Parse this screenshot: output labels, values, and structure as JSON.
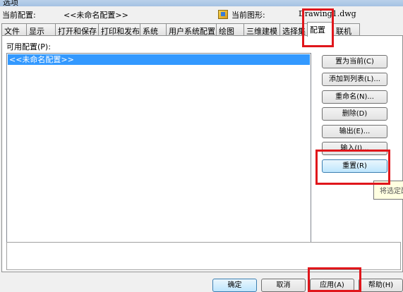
{
  "window": {
    "title": "选项"
  },
  "profile_row": {
    "current_profile_label": "当前配置:",
    "current_profile_value": "<<未命名配置>>",
    "current_drawing_label": "当前图形:",
    "current_drawing_value": "Drawing1.dwg"
  },
  "tabs": [
    {
      "label": "文件"
    },
    {
      "label": "显示"
    },
    {
      "label": "打开和保存"
    },
    {
      "label": "打印和发布"
    },
    {
      "label": "系统"
    },
    {
      "label": "用户系统配置"
    },
    {
      "label": "绘图"
    },
    {
      "label": "三维建模"
    },
    {
      "label": "选择集"
    },
    {
      "label": "配置"
    },
    {
      "label": "联机"
    }
  ],
  "active_tab": "配置",
  "panel": {
    "available_profiles_label": "可用配置(P):",
    "profiles": [
      "<<未命名配置>>"
    ],
    "description": ""
  },
  "side_buttons": {
    "set_current": "置为当前(C)",
    "add_to_list": "添加到列表(L)...",
    "rename": "重命名(N)...",
    "delete": "删除(D)",
    "export": "输出(E)...",
    "import": "输入(I)...",
    "reset": "重置(R)"
  },
  "tooltip": {
    "text": "将选定配"
  },
  "bottom_buttons": {
    "ok": "确定",
    "cancel": "取消",
    "apply": "应用(A)",
    "help": "帮助(H)"
  },
  "highlight_color": "#e0161b",
  "selection_color": "#3399ff"
}
